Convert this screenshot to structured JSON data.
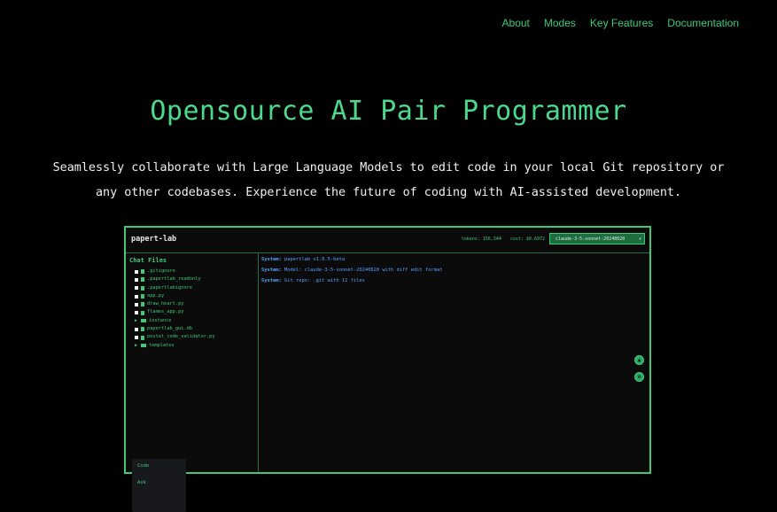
{
  "nav": {
    "items": [
      "About",
      "Modes",
      "Key Features",
      "Documentation"
    ]
  },
  "hero": {
    "title": "Opensource AI Pair Programmer",
    "subtitle_line1": "Seamlessly collaborate with Large Language Models to edit code in your local Git repository or",
    "subtitle_line2": "any other codebases. Experience the future of coding with AI-assisted development."
  },
  "app": {
    "name": "papert-lab",
    "tokens": "tokens: 156,344",
    "cost": "cost: $0.6972",
    "model": "claude-3-5-sonnet-20240620",
    "sidebar_title": "Chat Files",
    "files": [
      {
        "name": ".gitignore",
        "type": "file"
      },
      {
        "name": ".papertlab_readonly",
        "type": "file"
      },
      {
        "name": ".papertlabignore",
        "type": "file"
      },
      {
        "name": "app.py",
        "type": "file"
      },
      {
        "name": "draw_heart.py",
        "type": "file"
      },
      {
        "name": "flames_app.py",
        "type": "file"
      },
      {
        "name": "instance",
        "type": "folder"
      },
      {
        "name": "papertlab_gui.db",
        "type": "file"
      },
      {
        "name": "postal_code_validator.py",
        "type": "file"
      },
      {
        "name": "templates",
        "type": "folder"
      }
    ],
    "modes": [
      "Code",
      "Ask"
    ],
    "messages": [
      {
        "prefix": "System:",
        "text": "papertlab v1.0.5-beta"
      },
      {
        "prefix": "System:",
        "text": "Model: claude-3-5-sonnet-20240620 with diff edit format"
      },
      {
        "prefix": "System:",
        "text": "Git repo: .git with 11 files"
      }
    ]
  },
  "colors": {
    "accent": "#3ec97a",
    "title": "#4bd98c",
    "system_msg": "#5aa0ff",
    "bg": "#000000"
  }
}
